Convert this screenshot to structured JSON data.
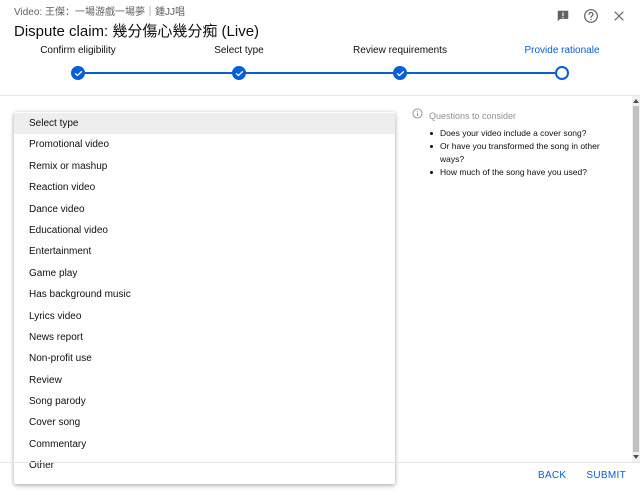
{
  "header": {
    "video_line": "Video: 王傑：一場游戲一場夢｜鍾JJ唱",
    "title": "Dispute claim: 幾分傷心幾分痴 (Live)"
  },
  "stepper": {
    "steps": [
      {
        "label": "Confirm eligibility",
        "state": "done"
      },
      {
        "label": "Select type",
        "state": "done"
      },
      {
        "label": "Review requirements",
        "state": "done"
      },
      {
        "label": "Provide rationale",
        "state": "current"
      }
    ],
    "accent": "#065fd4"
  },
  "dropdown": {
    "options": [
      "Select type",
      "Promotional video",
      "Remix or mashup",
      "Reaction video",
      "Dance video",
      "Educational video",
      "Entertainment",
      "Game play",
      "Has background music",
      "Lyrics video",
      "News report",
      "Non-profit use",
      "Review",
      "Song parody",
      "Cover song",
      "Commentary",
      "Other"
    ],
    "selected": "Select type"
  },
  "questions": {
    "heading": "Questions to consider",
    "items": [
      "Does your video include a cover song?",
      "Or have you transformed the song in other ways?",
      "How much of the song have you used?"
    ]
  },
  "footer": {
    "back_label": "BACK",
    "submit_label": "SUBMIT"
  },
  "icons": {
    "feedback": "feedback-icon",
    "help": "help-icon",
    "close": "close-icon",
    "info": "info-icon"
  }
}
